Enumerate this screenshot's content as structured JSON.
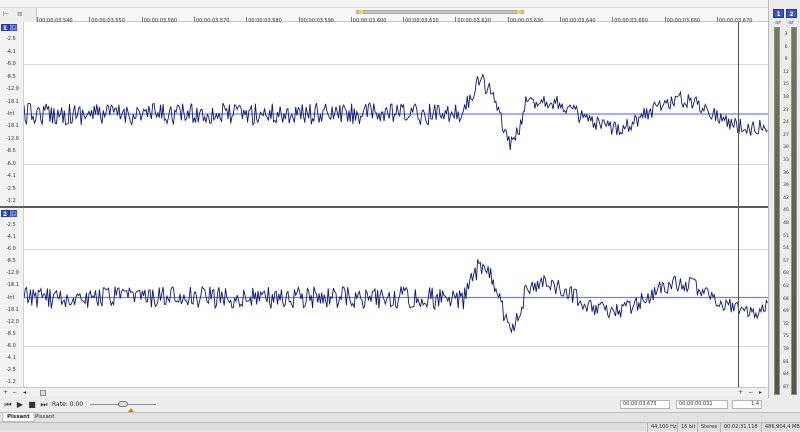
{
  "ruler": {
    "labels": [
      "00:00:03.540",
      "00:00:03.550",
      "00:00:03.560",
      "00:00:03.570",
      "00:00:03.580",
      "00:00:03.590",
      "00:00:03.600",
      "00:00:03.610",
      "00:00:03.620",
      "00:00:03.630",
      "00:00:03.640",
      "00:00:03.650",
      "00:00:03.660",
      "00:00:03.670"
    ]
  },
  "tracks": [
    {
      "channel": "1",
      "y_labels": [
        "-1.2",
        "-2.5",
        "-4.1",
        "-6.0",
        "-8.5",
        "-12.0",
        "-18.1",
        "-Inf",
        "-18.1",
        "-12.0",
        "-8.5",
        "-6.0",
        "-4.1",
        "-2.5",
        "-1.2"
      ]
    },
    {
      "channel": "2",
      "y_labels": [
        "-1.2",
        "-2.5",
        "-4.1",
        "-6.0",
        "-8.5",
        "-12.0",
        "-18.1",
        "-Inf",
        "-18.1",
        "-12.0",
        "-8.5",
        "-6.0",
        "-4.1",
        "-2.5",
        "-1.2"
      ]
    }
  ],
  "meter": {
    "channels": [
      "1",
      "2"
    ],
    "peaks": [
      "-Inf",
      "-Inf"
    ],
    "labels": [
      "3",
      "6",
      "9",
      "12",
      "15",
      "18",
      "21",
      "24",
      "27",
      "30",
      "33",
      "36",
      "39",
      "42",
      "45",
      "48",
      "51",
      "54",
      "57",
      "60",
      "63",
      "66",
      "69",
      "72",
      "75",
      "78",
      "81",
      "84",
      "87"
    ]
  },
  "transport": {
    "rate_label": "Rate: 0.00",
    "cursor_time": "00:00:03.673",
    "selection_length": "00:00:00.031",
    "zoom": "1:4"
  },
  "tabs": [
    "Pissant",
    "Pissant"
  ],
  "status": {
    "sample_rate": "44,100 Hz",
    "bit_depth": "16 bit",
    "channels": "Stereo",
    "duration": "00:02:31.118",
    "disk": "486,904.4 MB"
  }
}
